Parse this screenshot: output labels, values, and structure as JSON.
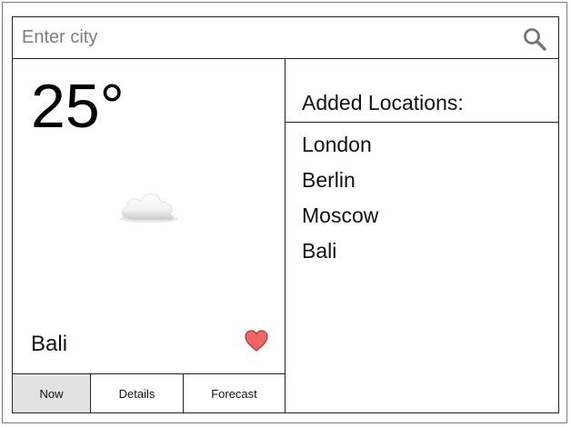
{
  "search": {
    "placeholder": "Enter city",
    "value": ""
  },
  "current": {
    "temperature": "25°",
    "condition_icon": "cloud-icon",
    "city": "Bali",
    "favorite_icon": "heart-icon",
    "favorite_color": "#ee6666"
  },
  "tabs": [
    {
      "label": "Now",
      "active": true
    },
    {
      "label": "Details",
      "active": false
    },
    {
      "label": "Forecast",
      "active": false
    }
  ],
  "locations": {
    "title": "Added Locations:",
    "items": [
      {
        "label": "London"
      },
      {
        "label": "Berlin"
      },
      {
        "label": "Moscow"
      },
      {
        "label": "Bali"
      }
    ]
  },
  "colors": {
    "border": "#222222",
    "active_tab_bg": "#e2e2e2",
    "search_icon": "#757575"
  }
}
